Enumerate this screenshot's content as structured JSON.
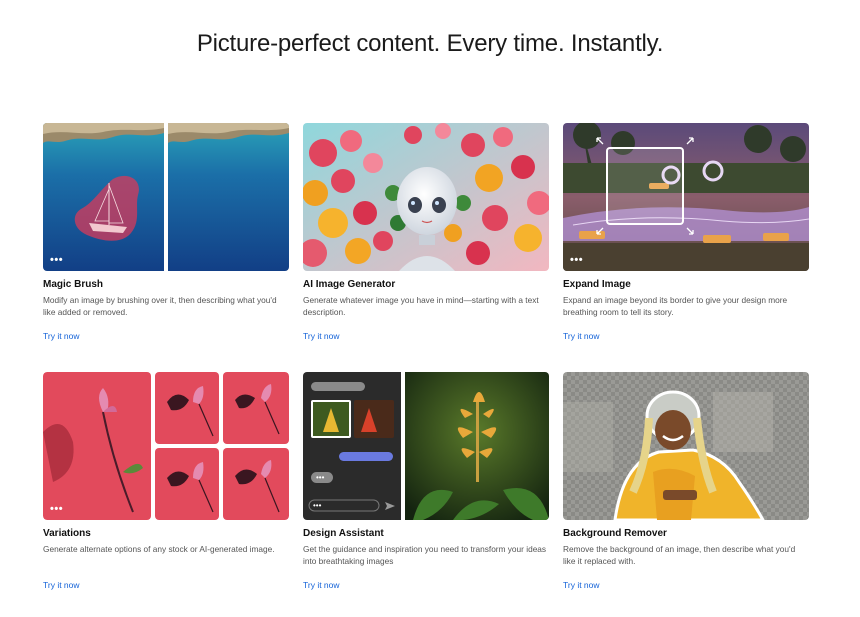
{
  "headline": "Picture-perfect content. Every time. Instantly.",
  "cards": [
    {
      "title": "Magic Brush",
      "description": "Modify an image by brushing over it, then describing what you'd like added or removed.",
      "link": "Try it now",
      "image": "ocean-sailboat-before-after"
    },
    {
      "title": "AI Image Generator",
      "description": "Generate whatever image you have in mind—starting with a text description.",
      "link": "Try it now",
      "image": "robot-among-flowers"
    },
    {
      "title": "Expand Image",
      "description": "Expand an image beyond its border to give your design more breathing room to tell its story.",
      "link": "Try it now",
      "image": "poolside-resort-expand-frame"
    },
    {
      "title": "Variations",
      "description": "Generate alternate options of any stock or AI-generated image.",
      "link": "Try it now",
      "image": "magnolia-on-red-variations"
    },
    {
      "title": "Design Assistant",
      "description": "Get the guidance and inspiration you need to transform your ideas into breathtaking images",
      "link": "Try it now",
      "image": "heliconia-plant-chat-panel"
    },
    {
      "title": "Background Remover",
      "description": "Remove the background of an image, then describe what you'd like it replaced with.",
      "link": "Try it now",
      "image": "woman-yellow-jacket-cutout"
    }
  ],
  "icons": {
    "more": "more-dots-icon",
    "expand": "expand-arrows-icon",
    "send": "send-icon"
  },
  "colors": {
    "link": "#1463d8",
    "text": "#1b1b1b",
    "muted": "#555555"
  }
}
